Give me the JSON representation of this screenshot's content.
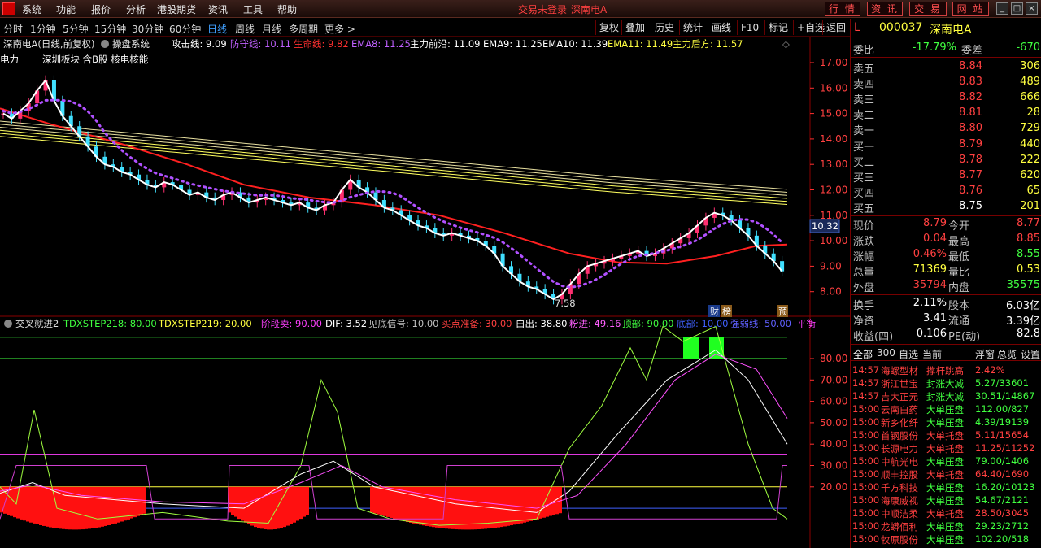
{
  "menu": {
    "items": [
      "系统",
      "功能",
      "报价",
      "分析",
      "港股期货",
      "资讯",
      "工具",
      "帮助"
    ],
    "status": "交易未登录",
    "stock": "深南电A",
    "buttons": [
      "行 情",
      "资 讯",
      "交 易",
      "网 站"
    ]
  },
  "periods": {
    "items": [
      "分时",
      "1分钟",
      "5分钟",
      "15分钟",
      "30分钟",
      "60分钟",
      "日线",
      "周线",
      "月线",
      "多周期",
      "更多 >"
    ],
    "active": "日线",
    "tools": [
      "复权",
      "叠加",
      "历史",
      "统计",
      "画线",
      "F10",
      "标记",
      "+自选",
      "返回"
    ]
  },
  "main_chart": {
    "title": "深南电A(日线,前复权)",
    "system": "操盘系统",
    "indicators": [
      {
        "label": "攻击线: 9.09",
        "color": "#ffffff"
      },
      {
        "label": "防守线: 10.11",
        "color": "#c060ff"
      },
      {
        "label": "生命线: 9.82",
        "color": "#ff3030"
      },
      {
        "label": "EMA8: 11.25",
        "color": "#c060ff"
      },
      {
        "label": "主力前沿: 11.09",
        "color": "#ffffff"
      },
      {
        "label": "EMA9: 11.25",
        "color": "#ffffff"
      },
      {
        "label": "EMA10: 11.39",
        "color": "#ffffff"
      },
      {
        "label": "EMA11: 11.49",
        "color": "#ffff40"
      },
      {
        "label": "主力后方: 11.57",
        "color": "#ffff40"
      }
    ],
    "concept_line1": "电力",
    "concept_line2": "深圳板块 含B股 核电核能",
    "y_ticks": [
      "17.00",
      "16.00",
      "15.00",
      "14.00",
      "13.00",
      "12.00",
      "11.00",
      "10.00",
      "9.00",
      "8.00"
    ],
    "low_label": "7.58",
    "price_marker": "10.32",
    "badges": [
      "财",
      "榜",
      "预"
    ]
  },
  "sub_chart": {
    "title": "交叉就进2",
    "indicators": [
      {
        "label": "TDXSTEP218: 80.00",
        "color": "#40ff40"
      },
      {
        "label": "TDXSTEP219: 20.00",
        "color": "#ffff40"
      },
      {
        "label": "阶段卖: 90.00",
        "color": "#ff40ff"
      },
      {
        "label": "DIF: 3.52",
        "color": "#ffffff"
      },
      {
        "label": "见底信号: 10.00",
        "color": "#c0c0c0"
      },
      {
        "label": "买点准备: 30.00",
        "color": "#ff4040"
      },
      {
        "label": "白出: 38.80",
        "color": "#ffffff"
      },
      {
        "label": "粉进: 49.16",
        "color": "#ff60ff"
      },
      {
        "label": "顶部: 90.00",
        "color": "#40ff40"
      },
      {
        "label": "底部: 10.00",
        "color": "#4060ff"
      },
      {
        "label": "强弱线: 50.00",
        "color": "#6060ff"
      },
      {
        "label": "平衡",
        "color": "#ff40ff"
      }
    ],
    "y_ticks": [
      "80.00",
      "70.00",
      "60.00",
      "50.00",
      "40.00",
      "30.00",
      "20.00"
    ]
  },
  "quote": {
    "code": "000037",
    "name": "深南电A",
    "tag": "L",
    "weibi_label": "委比",
    "weibi": "-17.79%",
    "weicha_label": "委差",
    "weicha": "-670",
    "asks": [
      {
        "label": "卖五",
        "price": "8.84",
        "vol": "306"
      },
      {
        "label": "卖四",
        "price": "8.83",
        "vol": "489"
      },
      {
        "label": "卖三",
        "price": "8.82",
        "vol": "666"
      },
      {
        "label": "卖二",
        "price": "8.81",
        "vol": "28"
      },
      {
        "label": "卖一",
        "price": "8.80",
        "vol": "729"
      }
    ],
    "bids": [
      {
        "label": "买一",
        "price": "8.79",
        "vol": "440"
      },
      {
        "label": "买二",
        "price": "8.78",
        "vol": "222"
      },
      {
        "label": "买三",
        "price": "8.77",
        "vol": "620"
      },
      {
        "label": "买四",
        "price": "8.76",
        "vol": "65"
      },
      {
        "label": "买五",
        "price": "8.75",
        "vol": "201"
      }
    ],
    "stats": [
      {
        "l1": "现价",
        "v1": "8.79",
        "c1": "#ff4040",
        "l2": "今开",
        "v2": "8.77",
        "c2": "#ff4040"
      },
      {
        "l1": "涨跌",
        "v1": "0.04",
        "c1": "#ff4040",
        "l2": "最高",
        "v2": "8.85",
        "c2": "#ff4040"
      },
      {
        "l1": "涨幅",
        "v1": "0.46%",
        "c1": "#ff4040",
        "l2": "最低",
        "v2": "8.55",
        "c2": "#40ff40"
      },
      {
        "l1": "总量",
        "v1": "71369",
        "c1": "#ffff40",
        "l2": "量比",
        "v2": "0.53",
        "c2": "#ffff40"
      },
      {
        "l1": "外盘",
        "v1": "35794",
        "c1": "#ff4040",
        "l2": "内盘",
        "v2": "35575",
        "c2": "#40ff40"
      }
    ],
    "stats2": [
      {
        "l1": "换手",
        "v1": "2.11%",
        "l2": "股本",
        "v2": "6.03亿"
      },
      {
        "l1": "净资",
        "v1": "3.41",
        "l2": "流通",
        "v2": "3.39亿"
      },
      {
        "l1": "收益(四)",
        "v1": "0.106",
        "l2": "PE(动)",
        "v2": "82.8"
      }
    ]
  },
  "tabs": {
    "items": [
      "全部",
      "300",
      "自选",
      "当前"
    ],
    "right": [
      "浮窗",
      "总览",
      "设置"
    ]
  },
  "news": [
    {
      "time": "14:57",
      "name": "海螺型材",
      "event": "撑杆跳高",
      "value": "2.42%"
    },
    {
      "time": "14:57",
      "name": "浙江世宝",
      "event": "封涨大减",
      "value": "5.27/33601"
    },
    {
      "time": "14:57",
      "name": "吉大正元",
      "event": "封涨大减",
      "value": "30.51/14867"
    },
    {
      "time": "15:00",
      "name": "云南白药",
      "event": "大单压盘",
      "value": "112.00/827"
    },
    {
      "time": "15:00",
      "name": "新乡化纤",
      "event": "大单压盘",
      "value": "4.39/19139"
    },
    {
      "time": "15:00",
      "name": "首钢股份",
      "event": "大单托盘",
      "value": "5.11/15654"
    },
    {
      "time": "15:00",
      "name": "长源电力",
      "event": "大单托盘",
      "value": "11.25/11252"
    },
    {
      "time": "15:00",
      "name": "中航光电",
      "event": "大单压盘",
      "value": "79.00/1406"
    },
    {
      "time": "15:00",
      "name": "顺丰控股",
      "event": "大单托盘",
      "value": "64.40/1690"
    },
    {
      "time": "15:00",
      "name": "千方科技",
      "event": "大单压盘",
      "value": "16.20/10123"
    },
    {
      "time": "15:00",
      "name": "海康威视",
      "event": "大单压盘",
      "value": "54.67/2121"
    },
    {
      "time": "15:00",
      "name": "中顺洁柔",
      "event": "大单托盘",
      "value": "28.50/3045"
    },
    {
      "time": "15:00",
      "name": "龙蟒佰利",
      "event": "大单压盘",
      "value": "29.23/2712"
    },
    {
      "time": "15:00",
      "name": "牧原股份",
      "event": "大单压盘",
      "value": "102.20/518"
    }
  ]
}
